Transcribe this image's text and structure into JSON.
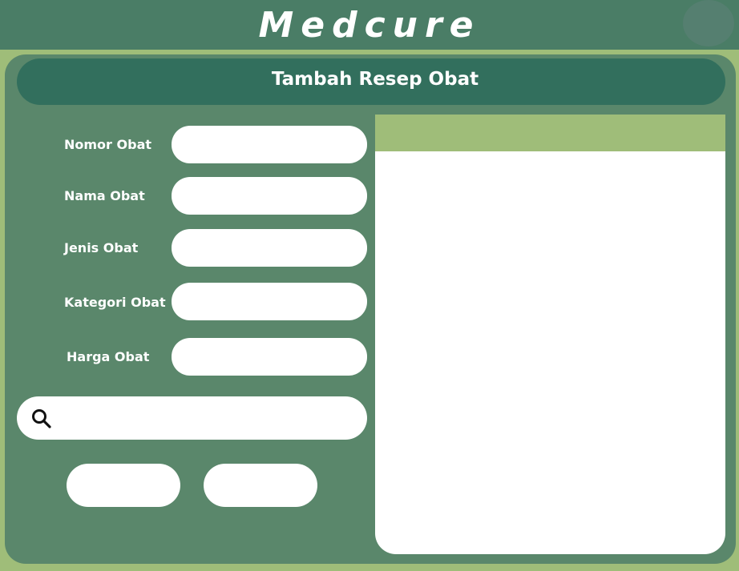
{
  "app": {
    "title": "Medcure"
  },
  "header": {
    "title": "Tambah Resep Obat"
  },
  "form": {
    "fields": [
      {
        "label": "Nomor Obat",
        "value": ""
      },
      {
        "label": "Nama Obat",
        "value": ""
      },
      {
        "label": "Jenis Obat",
        "value": ""
      },
      {
        "label": "Kategori Obat",
        "value": ""
      },
      {
        "label": "Harga Obat",
        "value": ""
      }
    ]
  },
  "search": {
    "value": "",
    "icon": "search-icon"
  },
  "buttons": {
    "first_label": "",
    "second_label": ""
  },
  "table": {
    "columns": [],
    "rows": []
  },
  "colors": {
    "background": "#9fbd79",
    "topbar": "#4a7d66",
    "panel": "#5a876b",
    "header_pill": "#326f5d",
    "table_header": "#9fbd79",
    "input": "#ffffff"
  }
}
